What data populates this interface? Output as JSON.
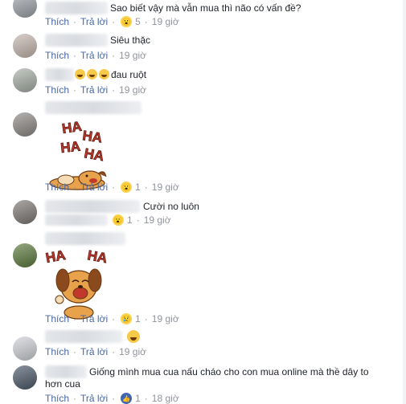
{
  "labels": {
    "like": "Thích",
    "reply": "Trả lời",
    "sep": "·"
  },
  "comments": [
    {
      "text": "Sao biết vậy mà vẫn mua thì não có vấn đề?",
      "reaction": "wow",
      "reaction_count": "5",
      "time": "19 giờ"
    },
    {
      "text": "Siêu thặc",
      "time": "19 giờ"
    },
    {
      "text": "đau ruột",
      "emoji_prefix": "🤣🤣🤣",
      "time": "19 giờ"
    },
    {
      "sticker": "HA HA dog lying",
      "reaction": "wow",
      "reaction_count": "1",
      "time": "19 giờ"
    },
    {
      "text": "Cười no luôn",
      "reaction": "wow",
      "reaction_count": "1",
      "time": "19 giờ"
    },
    {
      "sticker": "HA HA dog laughing",
      "reaction": "sad",
      "reaction_count": "1",
      "time": "19 giờ"
    },
    {
      "reaction_inline": "haha",
      "time": "19 giờ"
    },
    {
      "text_line1": "Giống mình mua cua nấu cháo cho con mua online mà thề dây to",
      "text_line2": "hơn cua",
      "reaction": "like",
      "reaction_count": "1",
      "time": "18 giờ"
    }
  ],
  "sticker_text": {
    "ha": "HA"
  },
  "colors": {
    "link": "#4b67a1",
    "meta": "#90949c",
    "text": "#1d2129"
  }
}
